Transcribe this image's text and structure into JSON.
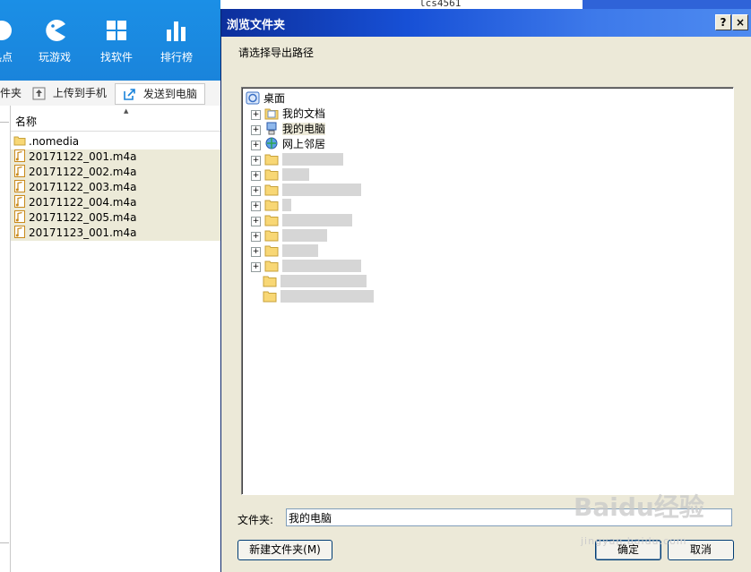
{
  "app": {
    "nav": [
      "热点",
      "玩游戏",
      "找软件",
      "排行榜"
    ],
    "toolbar": {
      "folder_label": "件夹",
      "upload_label": "上传到手机",
      "send_label": "发送到电脑"
    },
    "filelist": {
      "column_name": "名称",
      "files": [
        ".nomedia",
        "20171122_001.m4a",
        "20171122_002.m4a",
        "20171122_003.m4a",
        "20171122_004.m4a",
        "20171122_005.m4a",
        "20171123_001.m4a"
      ]
    }
  },
  "dialog": {
    "title": "浏览文件夹",
    "help_button": "?",
    "close_button": "×",
    "prompt": "请选择导出路径",
    "tree": {
      "root": "桌面",
      "items": [
        "我的文档",
        "我的电脑",
        "网上邻居"
      ]
    },
    "folder_label": "文件夹:",
    "folder_value": "我的电脑",
    "new_folder_button": "新建文件夹(M)",
    "ok_button": "确定",
    "cancel_button": "取消"
  },
  "topbar_text": "lcs4561",
  "watermark": {
    "brand": "Baidu经验",
    "url": "jingyan.baidu.com"
  },
  "colors": {
    "app_blue": "#1a84db",
    "dialog_title": "#0c2f9c",
    "dialog_bg": "#ece9d8",
    "selection": "#ecead8"
  }
}
